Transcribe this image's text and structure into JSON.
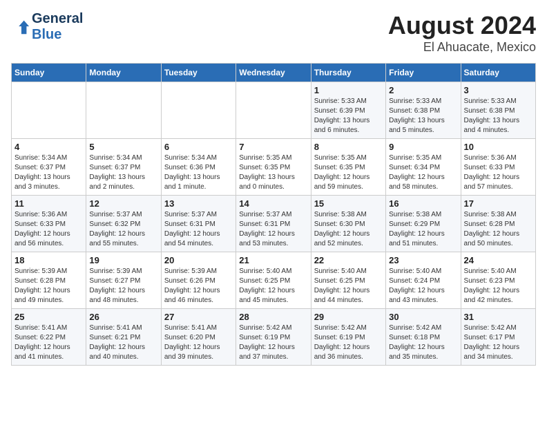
{
  "header": {
    "logo_line1": "General",
    "logo_line2": "Blue",
    "title": "August 2024",
    "subtitle": "El Ahuacate, Mexico"
  },
  "days_of_week": [
    "Sunday",
    "Monday",
    "Tuesday",
    "Wednesday",
    "Thursday",
    "Friday",
    "Saturday"
  ],
  "weeks": [
    [
      {
        "day": "",
        "info": ""
      },
      {
        "day": "",
        "info": ""
      },
      {
        "day": "",
        "info": ""
      },
      {
        "day": "",
        "info": ""
      },
      {
        "day": "1",
        "info": "Sunrise: 5:33 AM\nSunset: 6:39 PM\nDaylight: 13 hours\nand 6 minutes."
      },
      {
        "day": "2",
        "info": "Sunrise: 5:33 AM\nSunset: 6:38 PM\nDaylight: 13 hours\nand 5 minutes."
      },
      {
        "day": "3",
        "info": "Sunrise: 5:33 AM\nSunset: 6:38 PM\nDaylight: 13 hours\nand 4 minutes."
      }
    ],
    [
      {
        "day": "4",
        "info": "Sunrise: 5:34 AM\nSunset: 6:37 PM\nDaylight: 13 hours\nand 3 minutes."
      },
      {
        "day": "5",
        "info": "Sunrise: 5:34 AM\nSunset: 6:37 PM\nDaylight: 13 hours\nand 2 minutes."
      },
      {
        "day": "6",
        "info": "Sunrise: 5:34 AM\nSunset: 6:36 PM\nDaylight: 13 hours\nand 1 minute."
      },
      {
        "day": "7",
        "info": "Sunrise: 5:35 AM\nSunset: 6:35 PM\nDaylight: 13 hours\nand 0 minutes."
      },
      {
        "day": "8",
        "info": "Sunrise: 5:35 AM\nSunset: 6:35 PM\nDaylight: 12 hours\nand 59 minutes."
      },
      {
        "day": "9",
        "info": "Sunrise: 5:35 AM\nSunset: 6:34 PM\nDaylight: 12 hours\nand 58 minutes."
      },
      {
        "day": "10",
        "info": "Sunrise: 5:36 AM\nSunset: 6:33 PM\nDaylight: 12 hours\nand 57 minutes."
      }
    ],
    [
      {
        "day": "11",
        "info": "Sunrise: 5:36 AM\nSunset: 6:33 PM\nDaylight: 12 hours\nand 56 minutes."
      },
      {
        "day": "12",
        "info": "Sunrise: 5:37 AM\nSunset: 6:32 PM\nDaylight: 12 hours\nand 55 minutes."
      },
      {
        "day": "13",
        "info": "Sunrise: 5:37 AM\nSunset: 6:31 PM\nDaylight: 12 hours\nand 54 minutes."
      },
      {
        "day": "14",
        "info": "Sunrise: 5:37 AM\nSunset: 6:31 PM\nDaylight: 12 hours\nand 53 minutes."
      },
      {
        "day": "15",
        "info": "Sunrise: 5:38 AM\nSunset: 6:30 PM\nDaylight: 12 hours\nand 52 minutes."
      },
      {
        "day": "16",
        "info": "Sunrise: 5:38 AM\nSunset: 6:29 PM\nDaylight: 12 hours\nand 51 minutes."
      },
      {
        "day": "17",
        "info": "Sunrise: 5:38 AM\nSunset: 6:28 PM\nDaylight: 12 hours\nand 50 minutes."
      }
    ],
    [
      {
        "day": "18",
        "info": "Sunrise: 5:39 AM\nSunset: 6:28 PM\nDaylight: 12 hours\nand 49 minutes."
      },
      {
        "day": "19",
        "info": "Sunrise: 5:39 AM\nSunset: 6:27 PM\nDaylight: 12 hours\nand 48 minutes."
      },
      {
        "day": "20",
        "info": "Sunrise: 5:39 AM\nSunset: 6:26 PM\nDaylight: 12 hours\nand 46 minutes."
      },
      {
        "day": "21",
        "info": "Sunrise: 5:40 AM\nSunset: 6:25 PM\nDaylight: 12 hours\nand 45 minutes."
      },
      {
        "day": "22",
        "info": "Sunrise: 5:40 AM\nSunset: 6:25 PM\nDaylight: 12 hours\nand 44 minutes."
      },
      {
        "day": "23",
        "info": "Sunrise: 5:40 AM\nSunset: 6:24 PM\nDaylight: 12 hours\nand 43 minutes."
      },
      {
        "day": "24",
        "info": "Sunrise: 5:40 AM\nSunset: 6:23 PM\nDaylight: 12 hours\nand 42 minutes."
      }
    ],
    [
      {
        "day": "25",
        "info": "Sunrise: 5:41 AM\nSunset: 6:22 PM\nDaylight: 12 hours\nand 41 minutes."
      },
      {
        "day": "26",
        "info": "Sunrise: 5:41 AM\nSunset: 6:21 PM\nDaylight: 12 hours\nand 40 minutes."
      },
      {
        "day": "27",
        "info": "Sunrise: 5:41 AM\nSunset: 6:20 PM\nDaylight: 12 hours\nand 39 minutes."
      },
      {
        "day": "28",
        "info": "Sunrise: 5:42 AM\nSunset: 6:19 PM\nDaylight: 12 hours\nand 37 minutes."
      },
      {
        "day": "29",
        "info": "Sunrise: 5:42 AM\nSunset: 6:19 PM\nDaylight: 12 hours\nand 36 minutes."
      },
      {
        "day": "30",
        "info": "Sunrise: 5:42 AM\nSunset: 6:18 PM\nDaylight: 12 hours\nand 35 minutes."
      },
      {
        "day": "31",
        "info": "Sunrise: 5:42 AM\nSunset: 6:17 PM\nDaylight: 12 hours\nand 34 minutes."
      }
    ]
  ]
}
